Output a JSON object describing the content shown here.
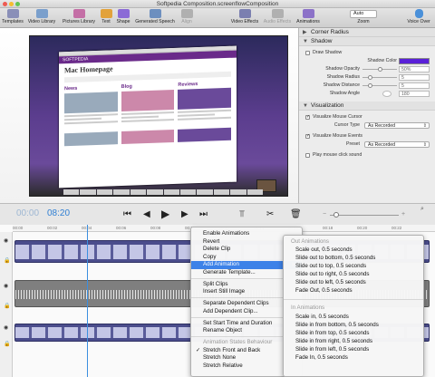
{
  "window": {
    "title": "Softpedia Composition.screenflowComposition"
  },
  "toolbar": {
    "left": [
      {
        "label": "Templates",
        "icon": "templates-icon",
        "color": "#8a8fb8"
      },
      {
        "label": "Video Library",
        "icon": "video-library-icon",
        "color": "#7a9fcc"
      },
      {
        "label": "Pictures Library",
        "icon": "pictures-library-icon",
        "color": "#c46fa6"
      },
      {
        "label": "Text",
        "icon": "text-icon",
        "color": "#e2a23a"
      },
      {
        "label": "Shape",
        "icon": "shape-icon",
        "color": "#8b6bd6"
      },
      {
        "label": "Generated Speech",
        "icon": "generated-speech-icon",
        "color": "#6d8fbf"
      },
      {
        "label": "Align",
        "icon": "align-icon",
        "color": "#b0b0b0"
      }
    ],
    "right": [
      {
        "label": "Video Effects",
        "icon": "video-effects-icon",
        "color": "#7b7fb0"
      },
      {
        "label": "Audio Effects",
        "icon": "audio-effects-icon",
        "color": "#b0b0b0"
      },
      {
        "label": "Animations",
        "icon": "animations-icon",
        "color": "#8c72c8"
      }
    ],
    "zoom": {
      "value": "Auto",
      "label": "Zoom"
    },
    "voice_over": {
      "label": "Voice Over",
      "icon": "microphone-icon",
      "color": "#4a90d9"
    }
  },
  "preview": {
    "site_title": "Mac Homepage",
    "site_nav": "SOFTPEDIA",
    "col_news": "News",
    "col_blog": "Blog",
    "col_reviews": "Reviews"
  },
  "panel": {
    "corner_radius": {
      "title": "Corner Radius"
    },
    "shadow": {
      "title": "Shadow",
      "draw_shadow": "Draw Shadow",
      "shadow_color_label": "Shadow Color",
      "shadow_color": "#5a20d8",
      "opacity_label": "Shadow Opacity",
      "opacity": "50%",
      "radius_label": "Shadow Radius",
      "radius": "5",
      "distance_label": "Shadow Distance",
      "distance": "5",
      "angle_label": "Shadow Angle",
      "angle": "180"
    },
    "visualization": {
      "title": "Visualization",
      "visualize_cursor": "Visualize Mouse Cursor",
      "cursor_type_label": "Cursor Type",
      "cursor_type": "As Recorded",
      "visualize_events": "Visualize Mouse Events",
      "preset_label": "Preset",
      "preset": "As Recorded",
      "play_click": "Play mouse click sound"
    }
  },
  "transport": {
    "time_prefix": "00:00",
    "time": "08:20"
  },
  "timeline": {
    "ruler": [
      "00:00",
      "00:02",
      "00:04",
      "00:06",
      "00:08",
      "00:10",
      "00:12",
      "00:14",
      "00:16",
      "00:18",
      "00:20",
      "00:22"
    ]
  },
  "context_menu": {
    "items": [
      "Enable Animations",
      "Revert",
      "Delete Clip",
      "Copy",
      "Add Animation",
      "Generate Template...",
      "Split Clips",
      "Insert Still Image",
      "Separate Dependent Clips",
      "Add Dependent Clip...",
      "Set Start Time and Duration",
      "Rename Object",
      "Animation States Behaviour",
      "Stretch Front and Back",
      "Stretch None",
      "Stretch Relative"
    ]
  },
  "submenu": {
    "out_header": "Out Animations",
    "out": [
      "Scale out, 0.5 seconds",
      "Slide out to bottom, 0.5 seconds",
      "Slide out to top, 0.5 seconds",
      "Slide out to right, 0.5 seconds",
      "Slide out to left, 0.5 seconds",
      "Fade Out, 0.5 seconds"
    ],
    "in_header": "In Animations",
    "in": [
      "Scale in, 0.5 seconds",
      "Slide in from bottom, 0.5 seconds",
      "Slide in from top, 0.5 seconds",
      "Slide in from right, 0.5 seconds",
      "Slide in from left, 0.5 seconds",
      "Fade In, 0.5 seconds"
    ]
  }
}
